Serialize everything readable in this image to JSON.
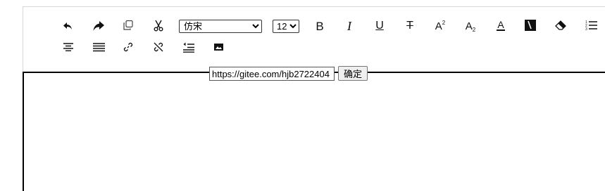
{
  "toolbar": {
    "font_family": {
      "selected": "仿宋"
    },
    "font_size": {
      "selected": "12"
    },
    "icons": [
      "undo-icon",
      "redo-icon",
      "copy-icon",
      "cut-icon",
      "bold-icon",
      "italic-icon",
      "underline-icon",
      "strikethrough-icon",
      "superscript-icon",
      "subscript-icon",
      "font-color-icon",
      "background-color-icon",
      "eraser-icon",
      "ordered-list-icon",
      "align-center-icon",
      "align-justify-icon",
      "link-icon",
      "unlink-icon",
      "outdent-icon",
      "image-icon"
    ],
    "glyphs": {
      "bold": "B",
      "italic": "I",
      "underline": "U",
      "strikethrough": "T",
      "superscript_base": "A",
      "superscript_mark": "2",
      "subscript_base": "A",
      "subscript_mark": "2",
      "font_color": "A"
    }
  },
  "link_dialog": {
    "url_value": "https://gitee.com/hjb2722404",
    "confirm_label": "确定"
  }
}
